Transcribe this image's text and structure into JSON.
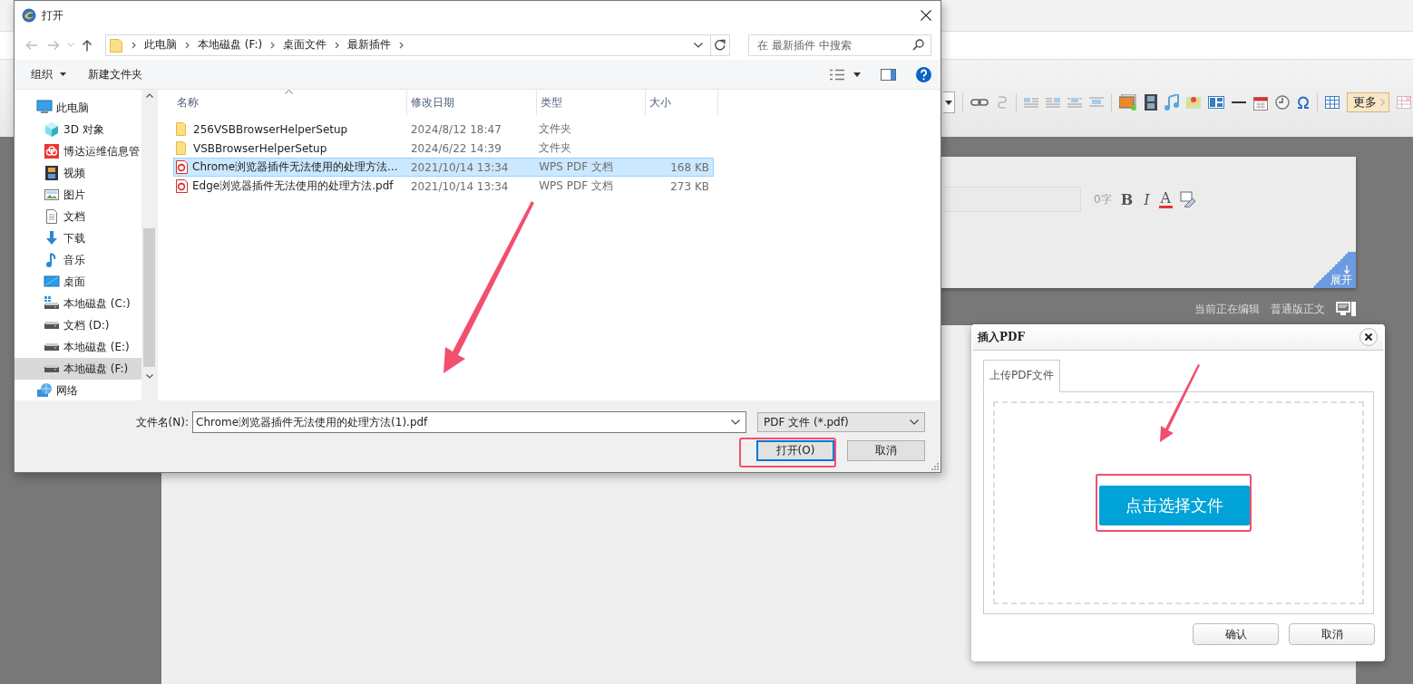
{
  "editor": {
    "toolbar": {
      "more_button": "更多"
    },
    "title_box": {
      "count": "0字",
      "bold": "B",
      "italic": "I",
      "font_color": "A",
      "expand": "展开"
    },
    "status": {
      "editing": "当前正在编辑",
      "mode": "普通版正文"
    }
  },
  "open_dialog": {
    "title": "打开",
    "breadcrumbs": [
      "此电脑",
      "本地磁盘 (F:)",
      "桌面文件",
      "最新插件"
    ],
    "search": {
      "placeholder": "在 最新插件 中搜索"
    },
    "commands": {
      "organize": "组织",
      "new_folder": "新建文件夹"
    },
    "nav_tree": [
      {
        "label": "此电脑",
        "kind": "pc",
        "selected": false,
        "children": [
          {
            "label": "3D 对象",
            "kind": "cube",
            "selected": false
          },
          {
            "label": "博达运维信息管",
            "kind": "cloud",
            "selected": false
          },
          {
            "label": "视频",
            "kind": "video",
            "selected": false
          },
          {
            "label": "图片",
            "kind": "picture",
            "selected": false
          },
          {
            "label": "文档",
            "kind": "document",
            "selected": false
          },
          {
            "label": "下载",
            "kind": "download",
            "selected": false
          },
          {
            "label": "音乐",
            "kind": "music",
            "selected": false
          },
          {
            "label": "桌面",
            "kind": "desktop",
            "selected": false
          },
          {
            "label": "本地磁盘 (C:)",
            "kind": "system-drive",
            "selected": false
          },
          {
            "label": "文档 (D:)",
            "kind": "drive",
            "selected": false
          },
          {
            "label": "本地磁盘 (E:)",
            "kind": "drive",
            "selected": false
          },
          {
            "label": "本地磁盘 (F:)",
            "kind": "drive",
            "selected": true
          }
        ]
      },
      {
        "label": "网络",
        "kind": "network",
        "selected": false
      }
    ],
    "file_list": {
      "columns": [
        "名称",
        "修改日期",
        "类型",
        "大小"
      ],
      "rows": [
        {
          "name": "256VSBBrowserHelperSetup",
          "modified": "2024/8/12 18:47",
          "type": "文件夹",
          "size": "",
          "kind": "folder",
          "selected": false
        },
        {
          "name": "VSBBrowserHelperSetup",
          "modified": "2024/6/22 14:39",
          "type": "文件夹",
          "size": "",
          "kind": "folder",
          "selected": false
        },
        {
          "name": "Chrome浏览器插件无法使用的处理方法...",
          "modified": "2021/10/14 13:34",
          "type": "WPS PDF 文档",
          "size": "168 KB",
          "kind": "pdf",
          "selected": true
        },
        {
          "name": "Edge浏览器插件无法使用的处理方法.pdf",
          "modified": "2021/10/14 13:34",
          "type": "WPS PDF 文档",
          "size": "273 KB",
          "kind": "pdf",
          "selected": false
        }
      ]
    },
    "file_name": {
      "label": "文件名(N):",
      "value": "Chrome浏览器插件无法使用的处理方法(1).pdf"
    },
    "file_type": "PDF 文件 (*.pdf)",
    "buttons": [
      {
        "label": "打开(O)",
        "kind": "primary"
      },
      {
        "label": "取消",
        "kind": "normal"
      }
    ]
  },
  "pdf_dialog": {
    "title": "插入PDF",
    "tabs": [
      {
        "label": "上传PDF文件",
        "selected": true
      }
    ],
    "choose_button": "点击选择文件",
    "buttons": [
      "确认",
      "取消"
    ]
  }
}
